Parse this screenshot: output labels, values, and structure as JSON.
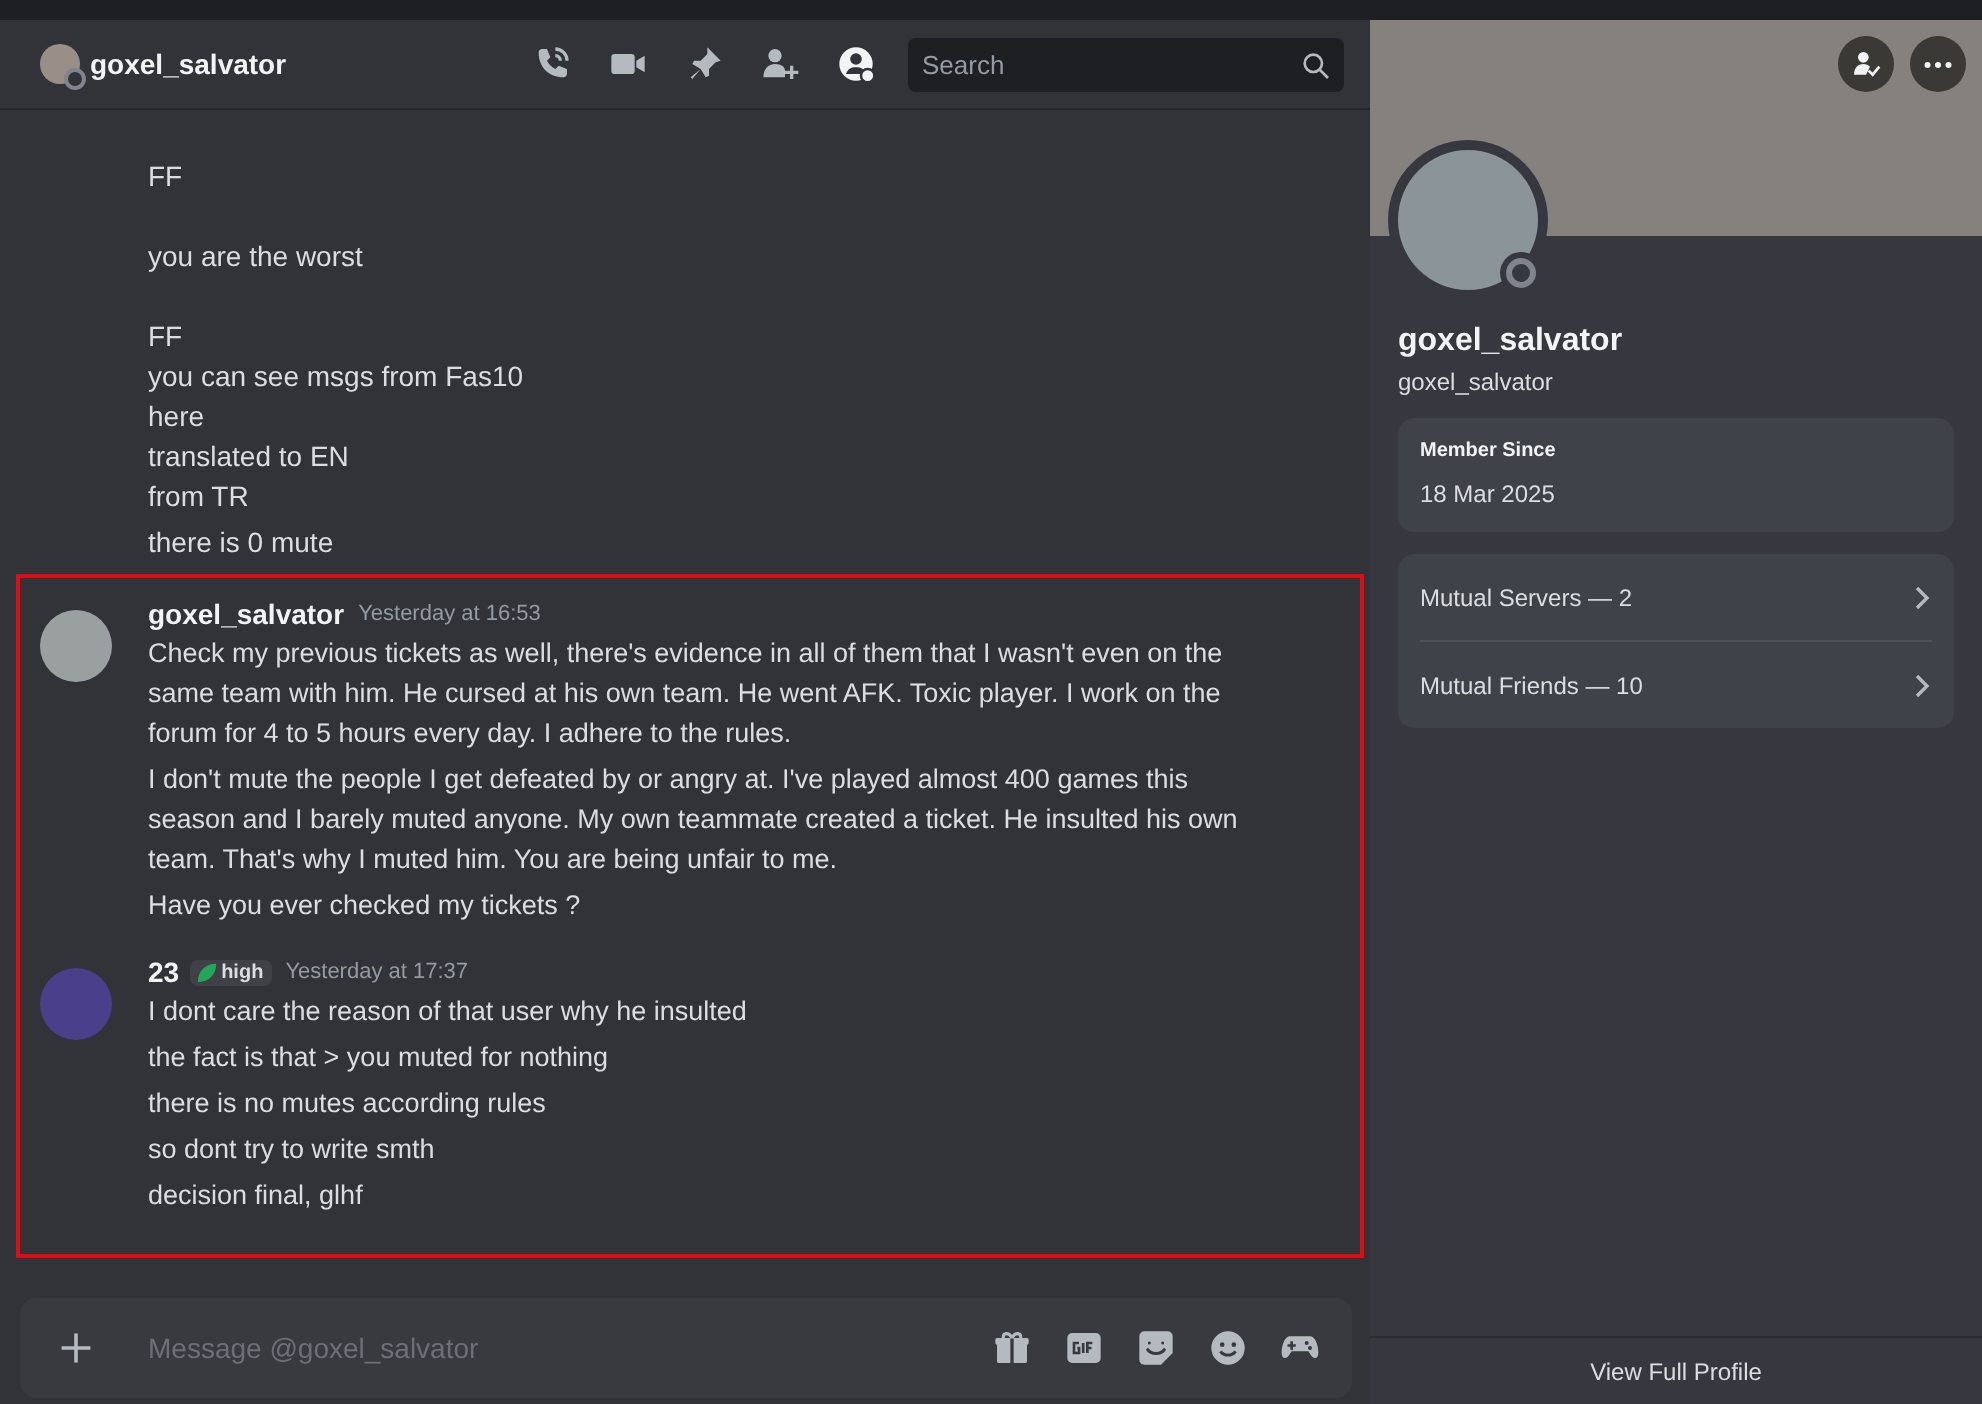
{
  "header": {
    "name": "goxel_salvator",
    "search": {
      "placeholder": "Search"
    }
  },
  "earlier_lines": [
    [
      "FF"
    ],
    [
      "you are the worst"
    ],
    [
      "FF",
      "you can see msgs from Fas10",
      "here",
      "translated to EN",
      "from TR"
    ],
    [
      "there is 0 mute"
    ]
  ],
  "highlight_frame": true,
  "messages": [
    {
      "author": "goxel_salvator",
      "time": "Yesterday at 16:53",
      "paragraphs": [
        "Check my previous tickets as well, there's evidence in all of them that I wasn't even on the same team with him. He cursed at his own team. He went AFK. Toxic player. I work on the forum for 4 to 5 hours every day. I adhere to the rules.",
        "I don't mute the people I get defeated by or angry at. I've played almost 400 games this season and I barely muted anyone. My own teammate created a ticket. He insulted his own team. That's why I muted him. You are being unfair to me.",
        "Have you ever checked my tickets ?"
      ]
    },
    {
      "author": "23",
      "badge": "high",
      "time": "Yesterday at 17:37",
      "paragraphs": [
        "I dont care the reason of that user why he insulted",
        "the fact is that > you muted for nothing",
        "there is no mutes according rules",
        "so dont try to write smth",
        "decision final, glhf"
      ]
    }
  ],
  "composer": {
    "placeholder": "Message @goxel_salvator"
  },
  "profile": {
    "display_name": "goxel_salvator",
    "username": "goxel_salvator",
    "member_since": {
      "label": "Member Since",
      "value": "18 Mar 2025"
    },
    "mutuals": [
      "Mutual Servers — 2",
      "Mutual Friends — 10"
    ],
    "footer": "View Full Profile"
  }
}
